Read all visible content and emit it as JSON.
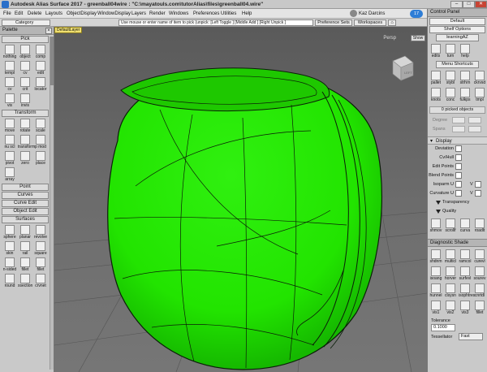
{
  "window": {
    "title": "Autodesk Alias Surface 2017  -  greenball04wire : \"C:\\mayatouls.com\\tutorAlias\\files\\greenball04.wire\"",
    "minimize": "–",
    "maximize": "□",
    "close": "✕"
  },
  "menu": {
    "items": [
      "File",
      "Edit",
      "Delete",
      "Layouts",
      "ObjectDisplay",
      "WindowDisplay",
      "Layers",
      "Render",
      "Windows",
      "Preferences",
      "Utilities",
      "Help"
    ],
    "user": "Kaz Darcins",
    "notifications": "17"
  },
  "toolbar": {
    "category": "Category",
    "prompt": "Use mouse or enter name of item to pick (unpick: [Left Toggle ] [Middle Add ] [Right Unpick ]",
    "preference_sets": "Preference Sets",
    "workspaces": "Workspaces"
  },
  "viewport": {
    "file_label": "DefaultLayer",
    "show": "Show",
    "view_label": "Persp",
    "viewcube_face": "LEFT"
  },
  "palette": {
    "title": "Palette",
    "sections": {
      "pick": "Pick",
      "transform": "Transform",
      "point": "Point",
      "curves": "Curves",
      "curve_edit": "Curve Edit",
      "object_edit": "Object Edit",
      "surfaces": "Surfaces"
    },
    "pick_tools": [
      "nothing",
      "object",
      "comp",
      "templ",
      "cv",
      "edit",
      "cv",
      "crit",
      "locator",
      "vis",
      "invis"
    ],
    "transform_tools": [
      "move",
      "rotate",
      "scale",
      "nu scl",
      "transform",
      "p mod",
      "pivot",
      "zero",
      "place",
      "array"
    ],
    "surface_tools": [
      "sphere",
      "planar",
      "revolve",
      "skin",
      "rail",
      "square",
      "n-sided",
      "fillet",
      "fillet",
      "round",
      "xsection",
      "crvnet"
    ]
  },
  "right_panel": {
    "control_panel": "Control Panel",
    "default": "Default",
    "shelf_options": "Shelf Options",
    "shelf_tab": "learningAZ",
    "shelf_tools": [
      "edits",
      "turn",
      "help"
    ],
    "menu_shortcuts": "Menu Shortcuts",
    "shortcut_tools": [
      "pallet",
      "stybl",
      "strhrn",
      "ckrvsd",
      "knots",
      "conc",
      "fulkps",
      "tmpl"
    ],
    "picked_objects": "0 picked objects",
    "degree": "Degree",
    "spans": "Spans",
    "display": "Display",
    "options": [
      {
        "label": "Deviation",
        "extra": false
      },
      {
        "label": "Cv/Hull",
        "extra": false
      },
      {
        "label": "Edit Points",
        "extra": false
      },
      {
        "label": "Blend Points",
        "extra": false
      },
      {
        "label": "Isoparm U",
        "extra": true
      },
      {
        "label": "Curvature U",
        "extra": true
      }
    ],
    "v_label": "V",
    "transparency": "Transparency",
    "quality": "Quality",
    "display_tools": [
      "shmov",
      "scrollf",
      "curva",
      "roadlt"
    ],
    "diag_shade": "Diagnostic Shade",
    "diag_tools": [
      "shdnm",
      "multicl",
      "ramcol",
      "curevl",
      "isoang",
      "horver",
      "surfevl",
      "sourev",
      "hunnel",
      "clsysn",
      "isophtres",
      "cnrtdl",
      "vis1",
      "vis2",
      "vis3",
      "fillet"
    ],
    "tolerance": "Tolerance",
    "tolerance_value": "0.1000",
    "tessellator": "Tessellator",
    "tessellator_value": "Fast"
  },
  "colors": {
    "surface": "#22e400",
    "surface_dark": "#13a800",
    "wire": "#0b1f08",
    "background": "#6e6e6e"
  }
}
